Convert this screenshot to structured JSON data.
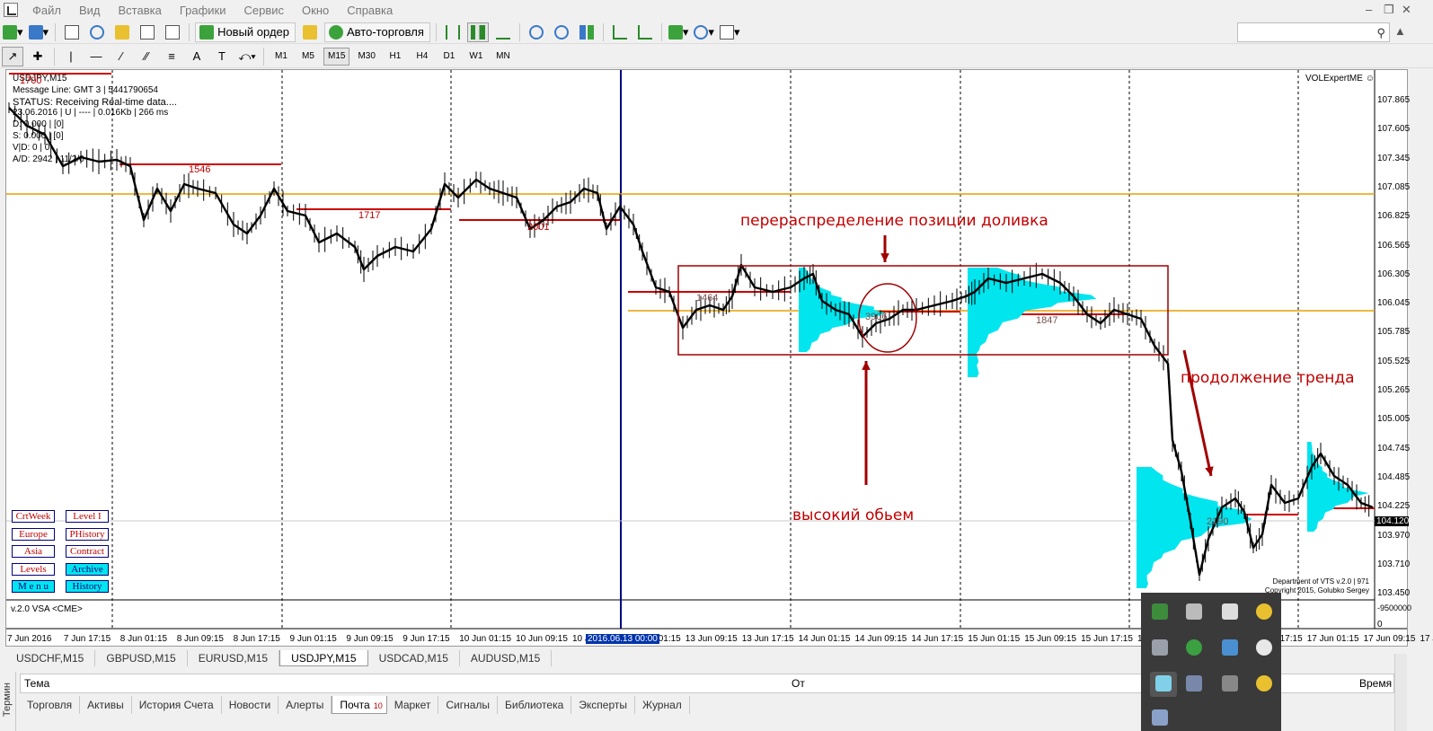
{
  "menu": {
    "items": [
      "Файл",
      "Вид",
      "Вставка",
      "Графики",
      "Сервис",
      "Окно",
      "Справка"
    ]
  },
  "toolbar": {
    "new_order_label": "Новый ордер",
    "auto_trading_label": "Авто-торговля",
    "timeframes": [
      "M1",
      "M5",
      "M15",
      "M30",
      "H1",
      "H4",
      "D1",
      "W1",
      "MN"
    ],
    "active_timeframe": "M15"
  },
  "chart": {
    "symbol_title": "USDJPY,M15",
    "info_lines": [
      "Message Line: GMT 3 | 5441790654",
      "STATUS:  Receiving Real-time data....",
      "23.06.2016 | U | ---- | 0.016Kb | 266 ms",
      "D: 0.000 | [0]",
      "S: 0.000 | [0]",
      "V|D: 0 | 0",
      "A/D: 2942 | 11/2/0"
    ],
    "top_left_number": "1700",
    "indicator_name": "VOLExpertME",
    "indicator_window_label": "v.2.0 VSA <CME>",
    "copyright_lines": [
      "Department of VTS  v.2.0 | 971",
      "Copyright 2015, Golubko Sergey"
    ],
    "price_labels": [
      "107.865",
      "107.605",
      "107.345",
      "107.085",
      "106.825",
      "106.565",
      "106.305",
      "106.045",
      "105.785",
      "105.525",
      "105.265",
      "105.005",
      "104.745",
      "104.485",
      "104.225",
      "103.970",
      "103.710",
      "103.450"
    ],
    "current_price": "104.120",
    "subwindow_scale": [
      "-9500000",
      "0"
    ],
    "time_labels": [
      "7 Jun 2016",
      "7 Jun 17:15",
      "8 Jun 01:15",
      "8 Jun 09:15",
      "8 Jun 17:15",
      "9 Jun 01:15",
      "9 Jun 09:15",
      "9 Jun 17:15",
      "10 Jun 01:15",
      "10 Jun 09:15",
      "10 Jun 17:15",
      "13 Jun 01:15",
      "13 Jun 09:15",
      "13 Jun 17:15",
      "14 Jun 01:15",
      "14 Jun 09:15",
      "14 Jun 17:15",
      "15 Jun 01:15",
      "15 Jun 09:15",
      "15 Jun 17:15",
      "16 Jun 01:15",
      "16 Jun 09:15",
      "16 Jun 17:15",
      "17 Jun 01:15",
      "17 Jun 09:15",
      "17 Jun 17:15"
    ],
    "highlight_time": "2016.06.13 00:00",
    "volume_labels": [
      "1546",
      "1717",
      "2001",
      "1464",
      "3906",
      "1847",
      "2190"
    ],
    "annotations": {
      "redistribution": "перераспределение позиции доливка",
      "high_volume": "высокий обьем",
      "trend_continuation": "продолжение тренда"
    },
    "colors": {
      "price_line": "#000000",
      "level_red": "#cc0000",
      "level_orange": "#e8a000",
      "profile_cyan": "#00e5ee",
      "session_blue": "#000080"
    }
  },
  "panel_buttons": [
    {
      "label": "CrtWeek",
      "style": "white"
    },
    {
      "label": "Level I",
      "style": "white"
    },
    {
      "label": "Europe",
      "style": "white"
    },
    {
      "label": "PHistory",
      "style": "white"
    },
    {
      "label": "Asia",
      "style": "white"
    },
    {
      "label": "Contract",
      "style": "white"
    },
    {
      "label": "Levels",
      "style": "white"
    },
    {
      "label": "Archive",
      "style": "cyan"
    },
    {
      "label": "M e n u",
      "style": "cyan"
    },
    {
      "label": "History",
      "style": "cyan"
    }
  ],
  "symbol_tabs": [
    "USDCHF,M15",
    "GBPUSD,M15",
    "EURUSD,M15",
    "USDJPY,M15",
    "USDCAD,M15",
    "AUDUSD,M15"
  ],
  "active_symbol_tab": "USDJPY,M15",
  "terminal": {
    "side_label": "Термин",
    "columns": [
      "Тема",
      "От",
      "Время"
    ],
    "tabs": [
      "Торговля",
      "Активы",
      "История Счета",
      "Новости",
      "Алерты",
      "Почта",
      "Маркет",
      "Сигналы",
      "Библиотека",
      "Эксперты",
      "Журнал"
    ],
    "active_tab": "Почта",
    "mail_badge": "10"
  }
}
